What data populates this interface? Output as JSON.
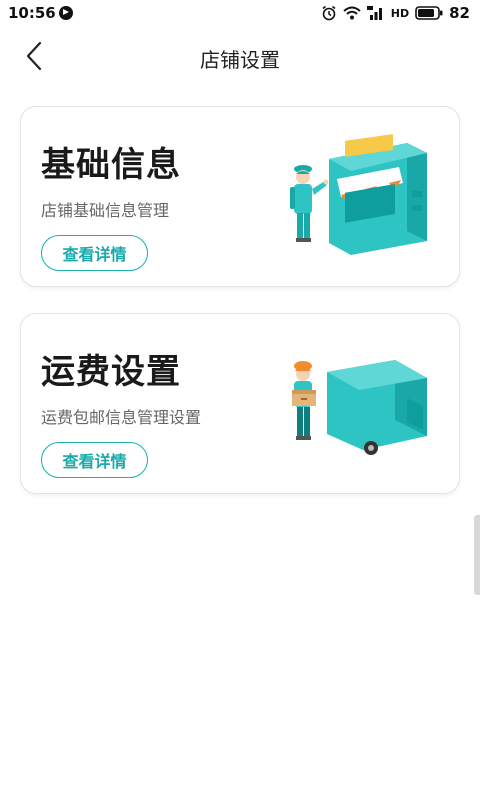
{
  "status_bar": {
    "time": "10:56",
    "hd_label": "HD",
    "battery_percent": "82"
  },
  "header": {
    "title": "店铺设置"
  },
  "cards": [
    {
      "title": "基础信息",
      "subtitle": "店铺基础信息管理",
      "button_label": "查看详情",
      "illustration": "shop-clerk-illustration"
    },
    {
      "title": "运费设置",
      "subtitle": "运费包邮信息管理设置",
      "button_label": "查看详情",
      "illustration": "delivery-truck-illustration"
    }
  ],
  "colors": {
    "accent": "#1ab0b0",
    "teal_dark": "#0f9e9e",
    "awning_orange": "#f28a2e",
    "sign_yellow": "#f7c948"
  }
}
